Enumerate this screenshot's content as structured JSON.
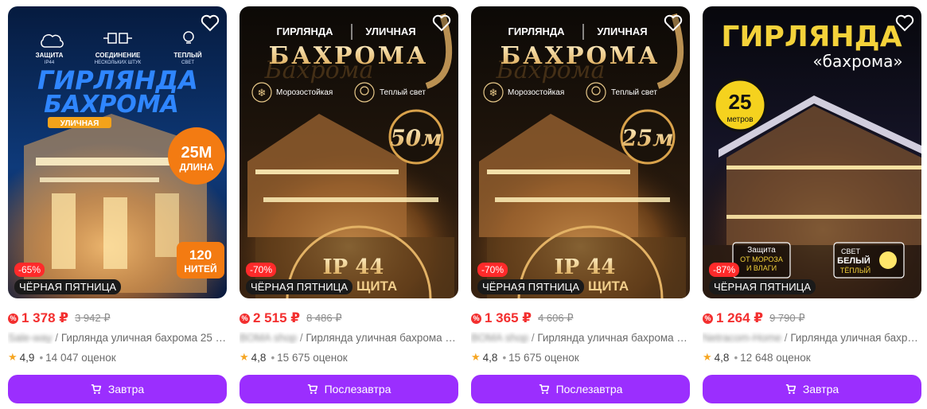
{
  "colors": {
    "accent": "#9b2efe",
    "price_red": "#f32f2f",
    "badge_red": "#ff2a2a",
    "promo_bg": "#1a1a1a",
    "star": "#f6a623"
  },
  "products": [
    {
      "image": {
        "kind": "poster-blue",
        "headline": [
          "ГИРЛЯНДА",
          "БАХРОМА"
        ],
        "tag": "УЛИЧНАЯ",
        "features": [
          {
            "icon": "rain-cloud-icon",
            "label": "ЗАЩИТА",
            "sub": "IP44"
          },
          {
            "icon": "connector-icon",
            "label": "СОЕДИНЕНИЕ",
            "sub": "НЕСКОЛЬКИХ ШТУК"
          },
          {
            "icon": "lamp-icon",
            "label": "ТЕПЛЫЙ",
            "sub": "СВЕТ"
          }
        ],
        "length_big": "25М",
        "length_small": "ДЛИНА",
        "threads_big": "120",
        "threads_small": "НИТЕЙ"
      },
      "discount": "-65%",
      "promo": "ЧЁРНАЯ ПЯТНИЦА",
      "price": "1 378 ₽",
      "old_price": "3 942 ₽",
      "seller": "Sale-way",
      "title": "Гирлянда уличная бахрома 25 …",
      "rating": "4,9",
      "reviews": "14 047 оценок",
      "delivery": "Завтра"
    },
    {
      "image": {
        "kind": "poster-gold",
        "top_left": "ГИРЛЯНДА",
        "top_right": "УЛИЧНАЯ",
        "headline": "БАХРОМА",
        "script": "Бахрома",
        "feature_left": "Морозостойкая",
        "feature_right": "Теплый свет",
        "badge": "50м",
        "bottom": "IP 44",
        "bottom_sub": "ЩИТА"
      },
      "discount": "-70%",
      "promo": "ЧЁРНАЯ ПЯТНИЦА",
      "price": "2 515 ₽",
      "old_price": "8 486 ₽",
      "seller": "BOMA shop",
      "title": "Гирлянда уличная бахрома …",
      "rating": "4,8",
      "reviews": "15 675 оценок",
      "delivery": "Послезавтра"
    },
    {
      "image": {
        "kind": "poster-gold",
        "top_left": "ГИРЛЯНДА",
        "top_right": "УЛИЧНАЯ",
        "headline": "БАХРОМА",
        "script": "Бахрома",
        "feature_left": "Морозостойкая",
        "feature_right": "Теплый свет",
        "badge": "25м",
        "bottom": "IP 44",
        "bottom_sub": "ЩИТА"
      },
      "discount": "-70%",
      "promo": "ЧЁРНАЯ ПЯТНИЦА",
      "price": "1 365 ₽",
      "old_price": "4 606 ₽",
      "seller": "BOMA shop",
      "title": "Гирлянда уличная бахрома …",
      "rating": "4,8",
      "reviews": "15 675 оценок",
      "delivery": "Послезавтра"
    },
    {
      "image": {
        "kind": "poster-night",
        "headline": "ГИРЛЯНДА",
        "subheadline": "«бахрома»",
        "badge_big": "25",
        "badge_small": "метров",
        "box_left": [
          "Защита",
          "ОТ МОРОЗА",
          "И ВЛАГИ"
        ],
        "box_right": [
          "СВЕТ",
          "БЕЛЫЙ",
          "ТЁПЛЫЙ"
        ]
      },
      "discount": "-87%",
      "promo": "ЧЁРНАЯ ПЯТНИЦА",
      "price": "1 264 ₽",
      "old_price": "9 790 ₽",
      "seller": "Netracom-Home",
      "title": "Гирлянда уличная бахрома …",
      "rating": "4,8",
      "reviews": "12 648 оценок",
      "delivery": "Завтра"
    }
  ]
}
